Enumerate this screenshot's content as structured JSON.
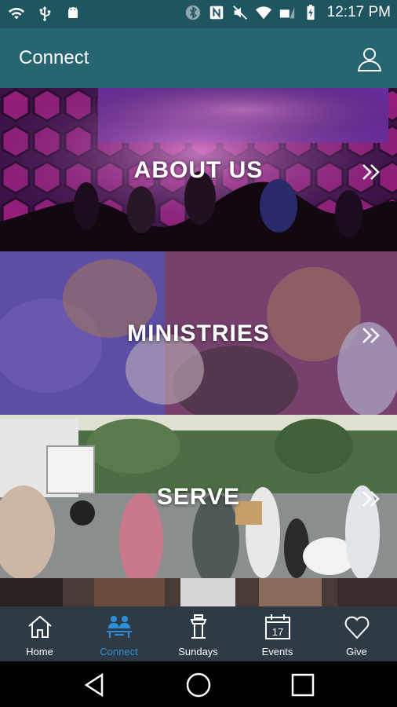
{
  "status_bar": {
    "time": "12:17 PM",
    "left_icons": [
      "wifi-icon",
      "usb-icon",
      "android-icon"
    ],
    "right_icons": [
      "bluetooth-icon",
      "nfc-icon",
      "mute-icon",
      "wifi-signal-icon",
      "cellular-signal-icon",
      "battery-icon"
    ]
  },
  "app_bar": {
    "title": "Connect",
    "profile_icon": "user-icon"
  },
  "tiles": [
    {
      "label": "ABOUT US",
      "chevron": "double-chevron-right-icon"
    },
    {
      "label": "MINISTRIES",
      "chevron": "double-chevron-right-icon"
    },
    {
      "label": "SERVE",
      "chevron": "double-chevron-right-icon"
    }
  ],
  "bottom_nav": {
    "active": "Connect",
    "active_color": "#2e8fd6",
    "items": [
      {
        "label": "Home",
        "icon": "home-icon"
      },
      {
        "label": "Connect",
        "icon": "people-icon"
      },
      {
        "label": "Sundays",
        "icon": "podium-icon"
      },
      {
        "label": "Events",
        "icon": "calendar-icon",
        "calendar_day": "17"
      },
      {
        "label": "Give",
        "icon": "heart-icon"
      }
    ]
  },
  "colors": {
    "status_bar": "#1f5560",
    "app_bar": "#276570",
    "bottom_nav": "#2e3a45"
  }
}
